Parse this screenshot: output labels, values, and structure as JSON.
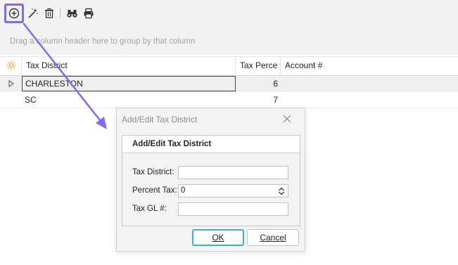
{
  "toolbar": {
    "buttons": [
      {
        "icon": "add-circle-icon"
      },
      {
        "icon": "magic-wand-icon"
      },
      {
        "icon": "trash-icon"
      },
      {
        "icon": "binoculars-icon"
      },
      {
        "icon": "print-icon"
      }
    ],
    "highlight_color": "#7b6cf2"
  },
  "group_panel": {
    "text": "Drag a column header here to group by that column"
  },
  "grid": {
    "columns": [
      {
        "label": "Tax District"
      },
      {
        "label": "Tax Perce"
      },
      {
        "label": "Account #"
      }
    ],
    "rows": [
      {
        "district": "CHARLESTON",
        "percent": "6",
        "account": "",
        "selected": true
      },
      {
        "district": "SC",
        "percent": "7",
        "account": "",
        "selected": false
      }
    ]
  },
  "dialog": {
    "title": "Add/Edit Tax District",
    "group_title": "Add/Edit Tax District",
    "fields": {
      "district": {
        "label": "Tax District:",
        "value": ""
      },
      "percent": {
        "label": "Percent Tax:",
        "value": "0"
      },
      "gl": {
        "label": "Tax GL #:",
        "value": ""
      }
    },
    "ok_label": "OK",
    "cancel_label": "Cancel"
  }
}
